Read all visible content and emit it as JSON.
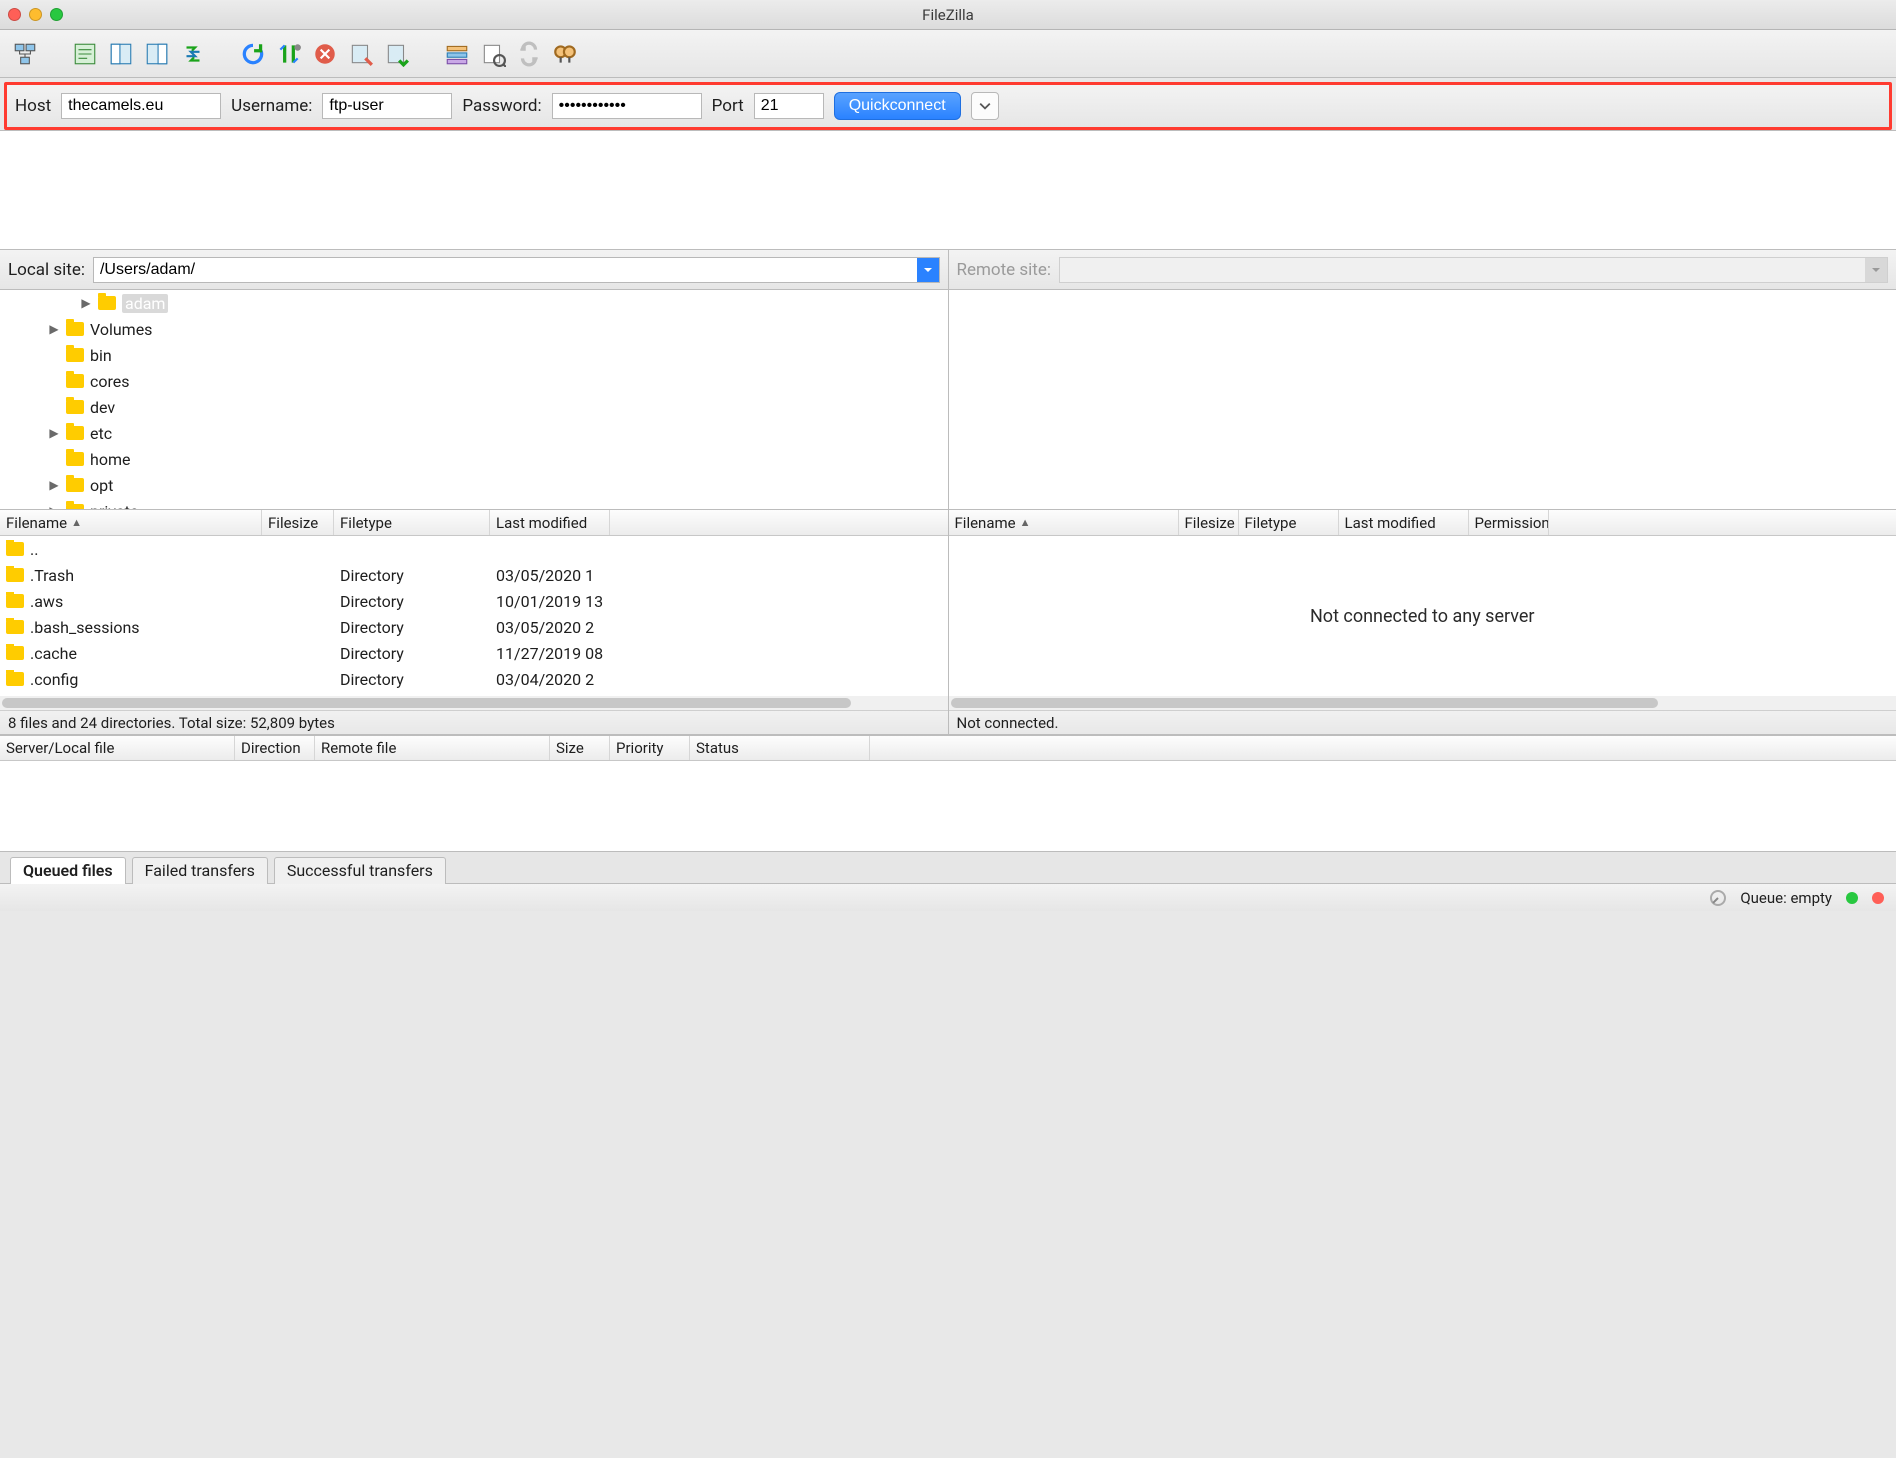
{
  "window": {
    "title": "FileZilla"
  },
  "quickconnect": {
    "host_label": "Host",
    "host_value": "thecamels.eu",
    "user_label": "Username:",
    "user_value": "ftp-user",
    "pass_label": "Password:",
    "pass_value": "••••••••••••",
    "port_label": "Port",
    "port_value": "21",
    "button": "Quickconnect"
  },
  "local": {
    "site_label": "Local site:",
    "site_value": "/Users/adam/",
    "tree": [
      {
        "indent": 5,
        "expander": "▶",
        "name": "adam",
        "selected": true
      },
      {
        "indent": 3,
        "expander": "▶",
        "name": "Volumes"
      },
      {
        "indent": 3,
        "expander": "",
        "name": "bin"
      },
      {
        "indent": 3,
        "expander": "",
        "name": "cores"
      },
      {
        "indent": 3,
        "expander": "",
        "name": "dev"
      },
      {
        "indent": 3,
        "expander": "▶",
        "name": "etc"
      },
      {
        "indent": 3,
        "expander": "",
        "name": "home"
      },
      {
        "indent": 3,
        "expander": "▶",
        "name": "opt"
      },
      {
        "indent": 3,
        "expander": "▶",
        "name": "private"
      }
    ],
    "columns": {
      "filename": "Filename",
      "filesize": "Filesize",
      "filetype": "Filetype",
      "lastmod": "Last modified"
    },
    "files": [
      {
        "name": "..",
        "size": "",
        "type": "",
        "mod": ""
      },
      {
        "name": ".Trash",
        "size": "",
        "type": "Directory",
        "mod": "03/05/2020 1"
      },
      {
        "name": ".aws",
        "size": "",
        "type": "Directory",
        "mod": "10/01/2019 13"
      },
      {
        "name": ".bash_sessions",
        "size": "",
        "type": "Directory",
        "mod": "03/05/2020 2"
      },
      {
        "name": ".cache",
        "size": "",
        "type": "Directory",
        "mod": "11/27/2019 08"
      },
      {
        "name": ".config",
        "size": "",
        "type": "Directory",
        "mod": "03/04/2020 2"
      }
    ],
    "status": "8 files and 24 directories. Total size: 52,809 bytes"
  },
  "remote": {
    "site_label": "Remote site:",
    "site_value": "",
    "columns": {
      "filename": "Filename",
      "filesize": "Filesize",
      "filetype": "Filetype",
      "lastmod": "Last modified",
      "permission": "Permission"
    },
    "empty_message": "Not connected to any server",
    "status": "Not connected."
  },
  "queue": {
    "columns": {
      "server": "Server/Local file",
      "direction": "Direction",
      "remote": "Remote file",
      "size": "Size",
      "priority": "Priority",
      "status": "Status"
    },
    "tabs": {
      "queued": "Queued files",
      "failed": "Failed transfers",
      "successful": "Successful transfers"
    }
  },
  "statusbar": {
    "queue": "Queue: empty"
  }
}
